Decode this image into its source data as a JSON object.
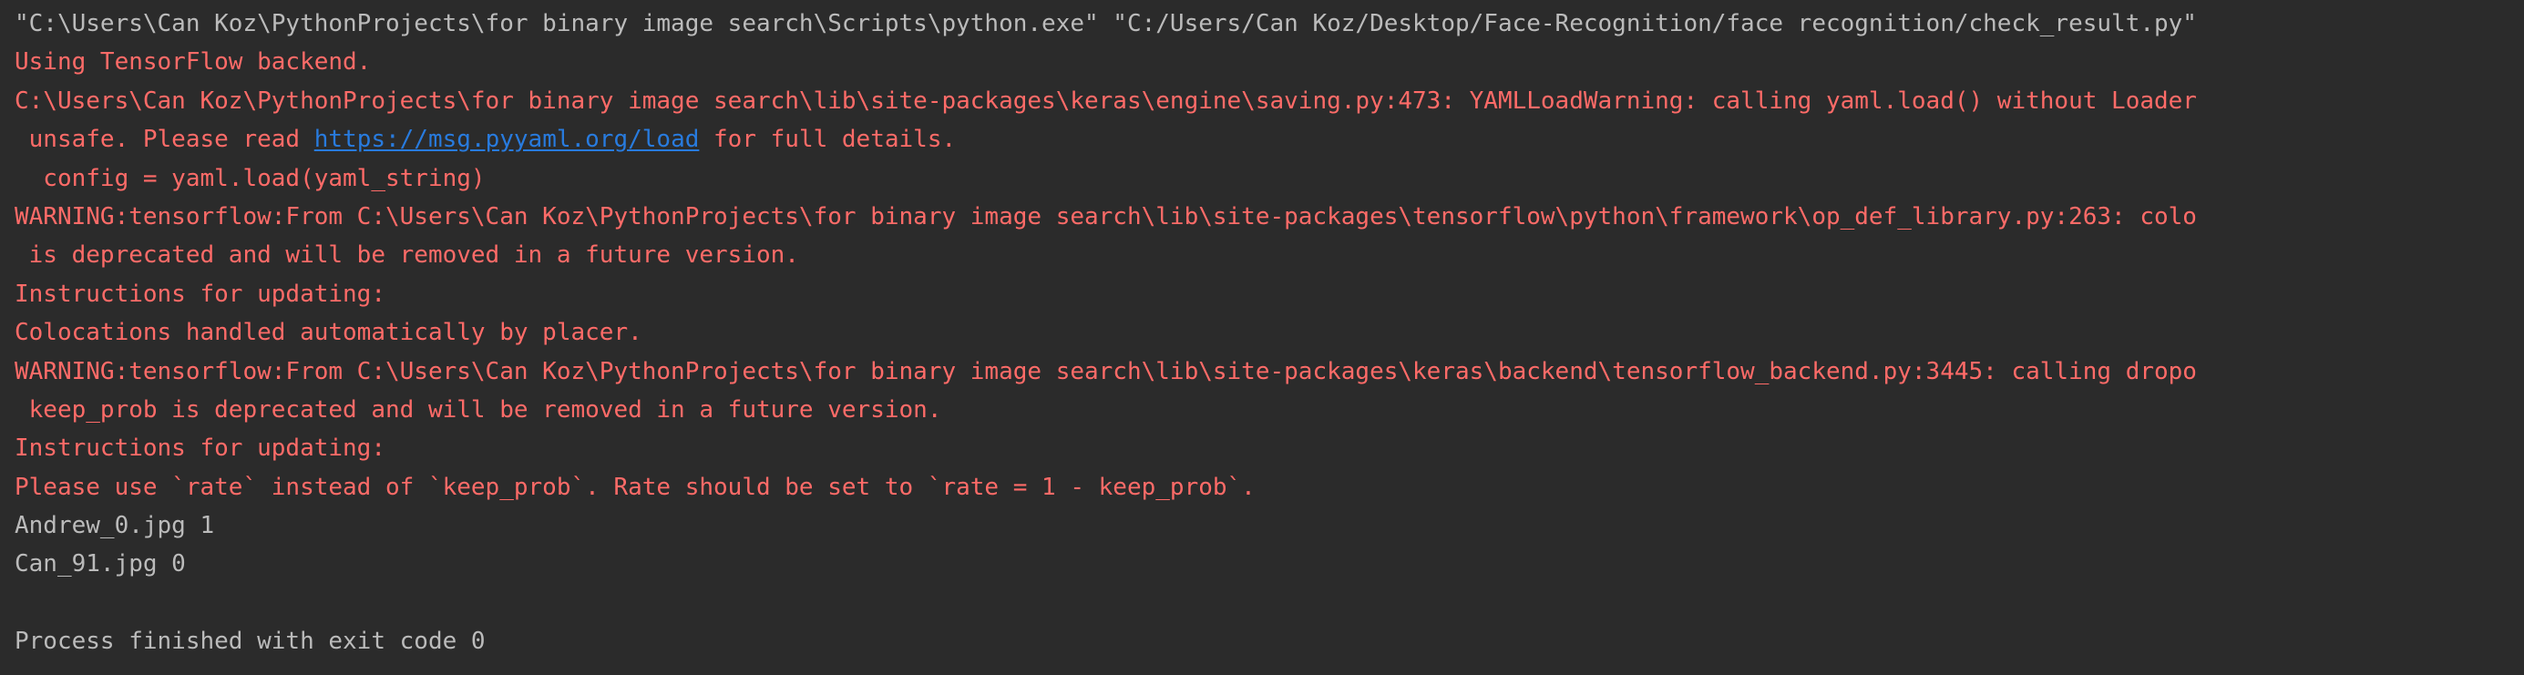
{
  "colors": {
    "background": "#2b2b2b",
    "stdout": "#bbbbbb",
    "stderr": "#ff6b68",
    "link": "#287bde"
  },
  "console": {
    "lines": [
      {
        "kind": "stdout",
        "segments": [
          {
            "text": "\"C:\\Users\\Can Koz\\PythonProjects\\for binary image search\\Scripts\\python.exe\" \"C:/Users/Can Koz/Desktop/Face-Recognition/face recognition/check_result.py\""
          }
        ]
      },
      {
        "kind": "stderr",
        "segments": [
          {
            "text": "Using TensorFlow backend."
          }
        ]
      },
      {
        "kind": "stderr",
        "segments": [
          {
            "text": "C:\\Users\\Can Koz\\PythonProjects\\for binary image search\\lib\\site-packages\\keras\\engine\\saving.py:473: YAMLLoadWarning: calling yaml.load() without Loader"
          }
        ]
      },
      {
        "kind": "stderr",
        "segments": [
          {
            "text": " unsafe. Please read "
          },
          {
            "text": "https://msg.pyyaml.org/load",
            "link": true
          },
          {
            "text": " for full details."
          }
        ]
      },
      {
        "kind": "stderr",
        "segments": [
          {
            "text": "  config = yaml.load(yaml_string)"
          }
        ]
      },
      {
        "kind": "stderr",
        "segments": [
          {
            "text": "WARNING:tensorflow:From C:\\Users\\Can Koz\\PythonProjects\\for binary image search\\lib\\site-packages\\tensorflow\\python\\framework\\op_def_library.py:263: colo"
          }
        ]
      },
      {
        "kind": "stderr",
        "segments": [
          {
            "text": " is deprecated and will be removed in a future version."
          }
        ]
      },
      {
        "kind": "stderr",
        "segments": [
          {
            "text": "Instructions for updating:"
          }
        ]
      },
      {
        "kind": "stderr",
        "segments": [
          {
            "text": "Colocations handled automatically by placer."
          }
        ]
      },
      {
        "kind": "stderr",
        "segments": [
          {
            "text": "WARNING:tensorflow:From C:\\Users\\Can Koz\\PythonProjects\\for binary image search\\lib\\site-packages\\keras\\backend\\tensorflow_backend.py:3445: calling dropo"
          }
        ]
      },
      {
        "kind": "stderr",
        "segments": [
          {
            "text": " keep_prob is deprecated and will be removed in a future version."
          }
        ]
      },
      {
        "kind": "stderr",
        "segments": [
          {
            "text": "Instructions for updating:"
          }
        ]
      },
      {
        "kind": "stderr",
        "segments": [
          {
            "text": "Please use `rate` instead of `keep_prob`. Rate should be set to `rate = 1 - keep_prob`."
          }
        ]
      },
      {
        "kind": "stdout",
        "segments": [
          {
            "text": "Andrew_0.jpg 1"
          }
        ]
      },
      {
        "kind": "stdout",
        "segments": [
          {
            "text": "Can_91.jpg 0"
          }
        ]
      },
      {
        "kind": "stdout",
        "segments": [
          {
            "text": ""
          }
        ]
      },
      {
        "kind": "stdout",
        "segments": [
          {
            "text": "Process finished with exit code 0"
          }
        ]
      }
    ]
  }
}
